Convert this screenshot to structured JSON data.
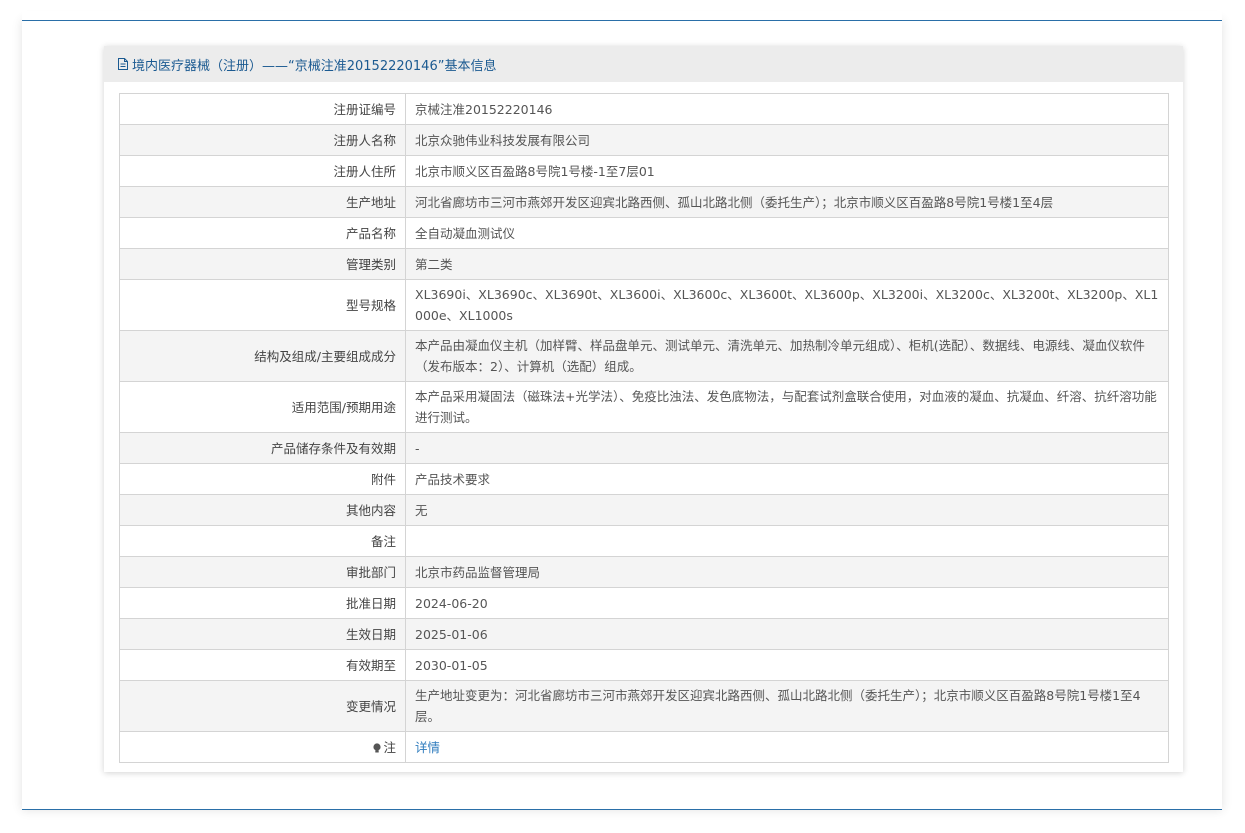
{
  "header": {
    "title": "境内医疗器械（注册）——“京械注准20152220146”基本信息"
  },
  "rows": [
    {
      "label": "注册证编号",
      "value": "京械注准20152220146"
    },
    {
      "label": "注册人名称",
      "value": "北京众驰伟业科技发展有限公司"
    },
    {
      "label": "注册人住所",
      "value": "北京市顺义区百盈路8号院1号楼-1至7层01"
    },
    {
      "label": "生产地址",
      "value": "河北省廊坊市三河市燕郊开发区迎宾北路西侧、孤山北路北侧（委托生产）；北京市顺义区百盈路8号院1号楼1至4层"
    },
    {
      "label": "产品名称",
      "value": "全自动凝血测试仪"
    },
    {
      "label": "管理类别",
      "value": "第二类"
    },
    {
      "label": "型号规格",
      "value": "XL3690i、XL3690c、XL3690t、XL3600i、XL3600c、XL3600t、XL3600p、XL3200i、XL3200c、XL3200t、XL3200p、XL1000e、XL1000s"
    },
    {
      "label": "结构及组成/主要组成成分",
      "value": "本产品由凝血仪主机（加样臂、样品盘单元、测试单元、清洗单元、加热制冷单元组成）、柜机(选配）、数据线、电源线、凝血仪软件（发布版本：2）、计算机（选配）组成。"
    },
    {
      "label": "适用范围/预期用途",
      "value": "本产品采用凝固法（磁珠法+光学法）、免疫比浊法、发色底物法，与配套试剂盒联合使用，对血液的凝血、抗凝血、纤溶、抗纤溶功能进行测试。"
    },
    {
      "label": "产品储存条件及有效期",
      "value": "-"
    },
    {
      "label": "附件",
      "value": "产品技术要求"
    },
    {
      "label": "其他内容",
      "value": "无"
    },
    {
      "label": "备注",
      "value": ""
    },
    {
      "label": "审批部门",
      "value": "北京市药品监督管理局"
    },
    {
      "label": "批准日期",
      "value": "2024-06-20"
    },
    {
      "label": "生效日期",
      "value": "2025-01-06"
    },
    {
      "label": "有效期至",
      "value": "2030-01-05"
    },
    {
      "label": "变更情况",
      "value": "生产地址变更为：河北省廊坊市三河市燕郊开发区迎宾北路西侧、孤山北路北侧（委托生产）；北京市顺义区百盈路8号院1号楼1至4层。"
    }
  ],
  "note": {
    "label": "注",
    "link": "详情"
  },
  "colors": {
    "accent": "#1b5a91",
    "link": "#2e7bbd",
    "border": "#d4d4d4",
    "stripe": "#f4f4f4"
  }
}
